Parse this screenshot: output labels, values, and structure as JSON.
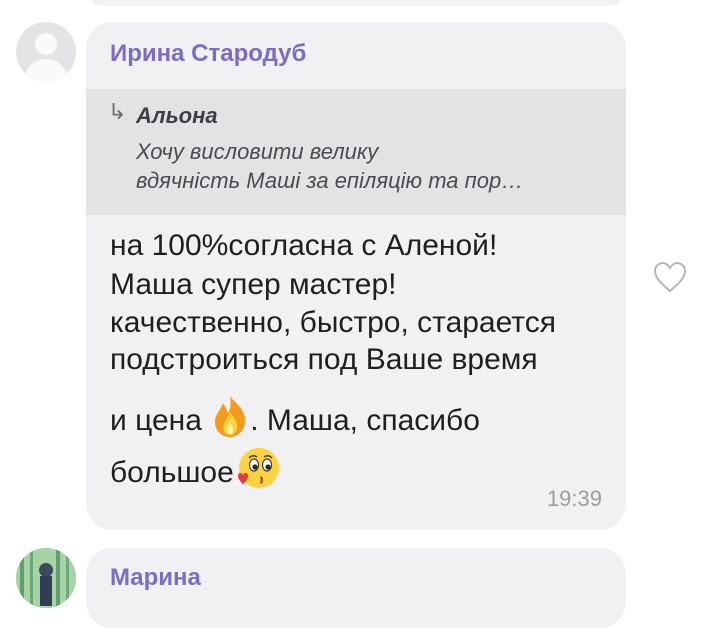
{
  "previous_message": {},
  "message": {
    "sender": "Ирина Стародуб",
    "reply": {
      "arrow": "↳",
      "author": "Альона",
      "text_line1": "Хочу висловити велику",
      "text_line2": "вдячність Маші за епіляцію та пор…"
    },
    "lines": {
      "l1": "на 100%согласна с Аленой!",
      "l2": "Маша супер мастер!",
      "l3": "качественно, быстро, старается",
      "l4": "подстроиться под Ваше время",
      "l5_before_emoji": "и цена",
      "l5_after_emoji": ". Маша, спасибо",
      "l6": "большое"
    },
    "emojis": [
      "fire-emoji",
      "kissing-face-emoji"
    ],
    "time": "19:39",
    "like_icon": "heart-outline-icon"
  },
  "next_message": {
    "sender": "Марина"
  },
  "colors": {
    "sender_name": "#7d6cc4",
    "bubble_bg": "#f1f1f3",
    "reply_bg": "#e3e3e6",
    "message_text": "#1f1f23",
    "time_text": "#9c9ca2"
  }
}
